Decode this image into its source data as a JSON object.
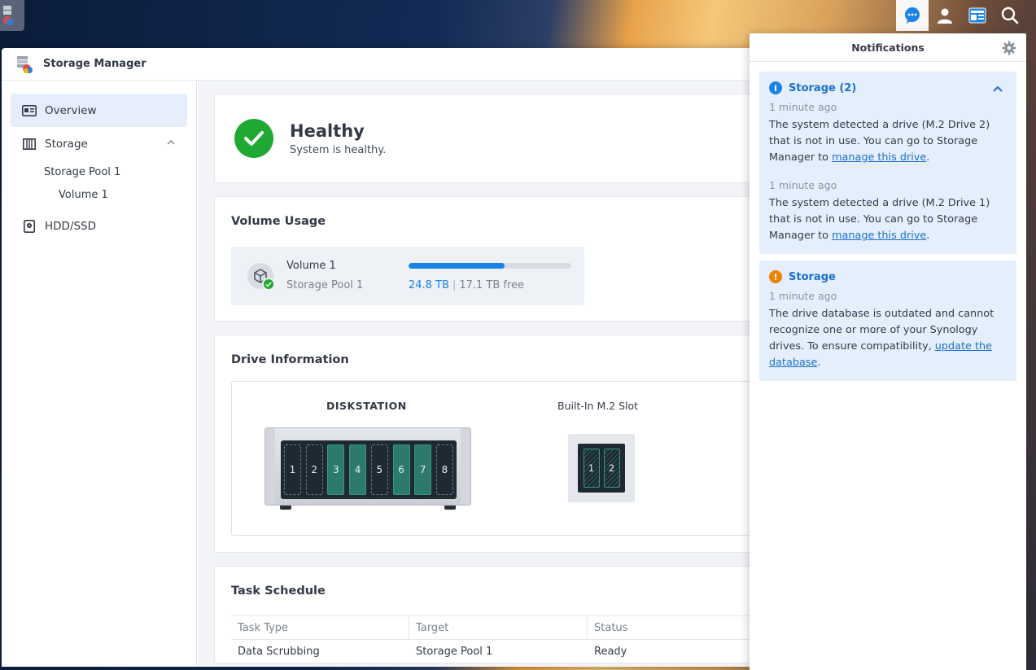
{
  "taskbar": {
    "icons": [
      "chat-icon",
      "user-icon",
      "widgets-icon",
      "search-icon"
    ]
  },
  "window": {
    "title": "Storage Manager"
  },
  "sidebar": {
    "items": [
      {
        "label": "Overview",
        "icon": "overview-icon"
      },
      {
        "label": "Storage",
        "icon": "storage-icon"
      },
      {
        "label": "Storage Pool 1"
      },
      {
        "label": "Volume 1"
      },
      {
        "label": "HDD/SSD",
        "icon": "hdd-icon"
      }
    ]
  },
  "health": {
    "title": "Healthy",
    "subtitle": "System is healthy."
  },
  "volume_usage": {
    "title": "Volume Usage",
    "volume_name": "Volume 1",
    "pool_name": "Storage Pool 1",
    "used": "24.8 TB",
    "separator": "|",
    "free": "17.1 TB free",
    "usage_fraction": 0.59
  },
  "drive_info": {
    "title": "Drive Information",
    "diskstation_label": "DISKSTATION",
    "m2_label": "Built-In M.2 Slot",
    "bays": [
      {
        "num": "1",
        "filled": false
      },
      {
        "num": "2",
        "filled": false
      },
      {
        "num": "3",
        "filled": true
      },
      {
        "num": "4",
        "filled": true
      },
      {
        "num": "5",
        "filled": false
      },
      {
        "num": "6",
        "filled": true
      },
      {
        "num": "7",
        "filled": true
      },
      {
        "num": "8",
        "filled": false
      }
    ],
    "m2_slots": [
      "1",
      "2"
    ]
  },
  "task_schedule": {
    "title": "Task Schedule",
    "columns": [
      "Task Type",
      "Target",
      "Status"
    ],
    "rows": [
      [
        "Data Scrubbing",
        "Storage Pool 1",
        "Ready"
      ]
    ]
  },
  "notifications": {
    "title": "Notifications",
    "groups": [
      {
        "title": "Storage (2)",
        "type": "info",
        "color": "#1a83e6",
        "items": [
          {
            "time": "1 minute ago",
            "text_before": "The system detected a drive (M.2 Drive 2) that is not in use. You can go to Storage Manager to ",
            "link": "manage this drive",
            "text_after": "."
          },
          {
            "time": "1 minute ago",
            "text_before": "The system detected a drive (M.2 Drive 1) that is not in use. You can go to Storage Manager to ",
            "link": "manage this drive",
            "text_after": "."
          }
        ]
      },
      {
        "title": "Storage",
        "type": "warning",
        "color": "#f08000",
        "items": [
          {
            "time": "1 minute ago",
            "text_before": "The drive database is outdated and cannot recognize one or more of your Synology drives. To ensure compatibility, ",
            "link": "update the database",
            "text_after": "."
          }
        ]
      }
    ]
  },
  "colors": {
    "accent": "#1a83e6",
    "healthy": "#1fa832",
    "drive_filled": "#2b7a6c"
  }
}
